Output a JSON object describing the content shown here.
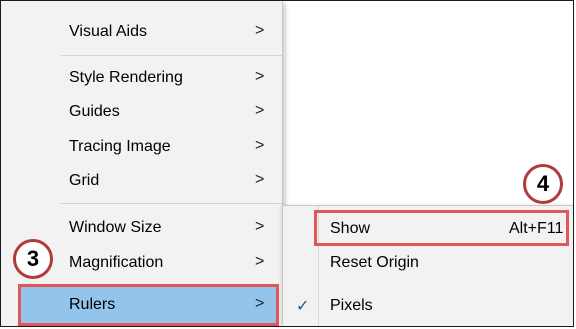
{
  "main_menu": {
    "items": [
      {
        "label": "Visual Aids",
        "arrow": ">"
      },
      {
        "label": "Style Rendering",
        "arrow": ">"
      },
      {
        "label": "Guides",
        "arrow": ">"
      },
      {
        "label": "Tracing Image",
        "arrow": ">"
      },
      {
        "label": "Grid",
        "arrow": ">"
      },
      {
        "label": "Window Size",
        "arrow": ">"
      },
      {
        "label": "Magnification",
        "arrow": ">"
      },
      {
        "label": "Rulers",
        "arrow": ">"
      }
    ]
  },
  "sub_menu": {
    "items": [
      {
        "label": "Show",
        "shortcut": "Alt+F11"
      },
      {
        "label": "Reset Origin"
      },
      {
        "label": "Pixels",
        "check": "✓"
      }
    ]
  },
  "annotations": {
    "step3": "3",
    "step4": "4",
    "highlight_color": "#e15759"
  }
}
